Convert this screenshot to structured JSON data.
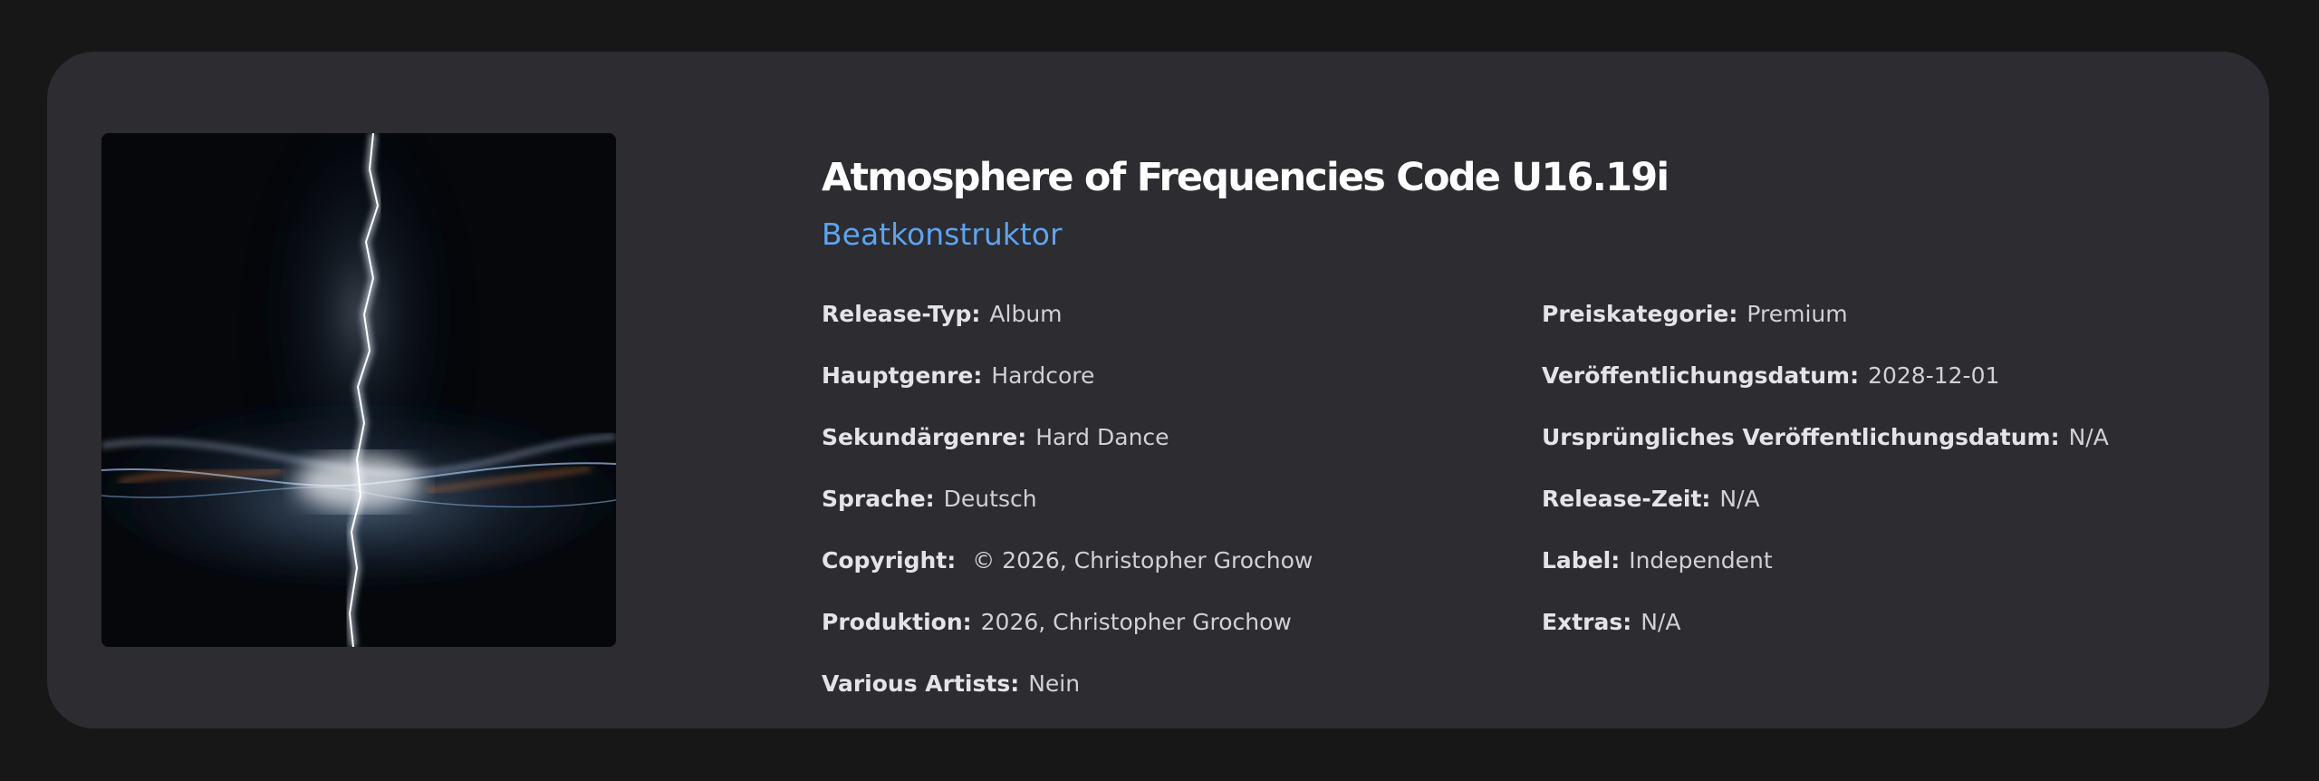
{
  "release": {
    "title": "Atmosphere of Frequencies Code U16.19i",
    "artist": "Beatkonstruktor",
    "cover_alt": "album-cover-lightning-art"
  },
  "details_left": [
    {
      "key": "Release-Typ:",
      "value": "Album"
    },
    {
      "key": "Hauptgenre:",
      "value": "Hardcore"
    },
    {
      "key": "Sekundärgenre:",
      "value": "Hard Dance"
    },
    {
      "key": "Sprache:",
      "value": "Deutsch"
    },
    {
      "key": "Copyright:",
      "value": " © 2026, Christopher Grochow"
    },
    {
      "key": "Produktion:",
      "value": "2026, Christopher Grochow"
    },
    {
      "key": "Various Artists:",
      "value": "Nein"
    }
  ],
  "details_right": [
    {
      "key": "Preiskategorie:",
      "value": "Premium"
    },
    {
      "key": "Veröffentlichungsdatum:",
      "value": "2028-12-01"
    },
    {
      "key": "Ursprüngliches Veröffentlichungsdatum:",
      "value": "N/A"
    },
    {
      "key": "Release-Zeit:",
      "value": "N/A"
    },
    {
      "key": "Label:",
      "value": "Independent"
    },
    {
      "key": "Extras:",
      "value": "N/A"
    }
  ],
  "colors": {
    "page_bg": "#171718",
    "card_bg": "#2c2c31",
    "title": "#ffffff",
    "artist_link": "#5ea3f0",
    "text": "#d9d9de"
  }
}
